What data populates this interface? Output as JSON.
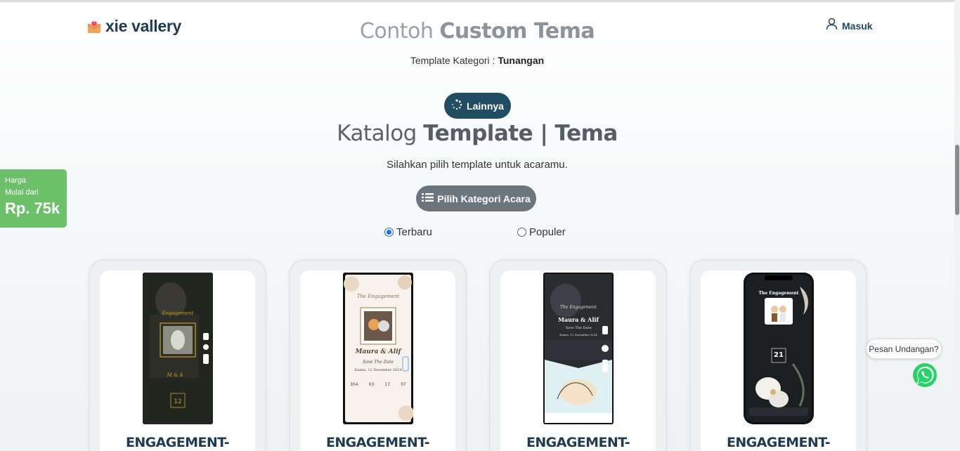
{
  "brand": {
    "name": "xie vallery"
  },
  "header": {
    "login_label": "Masuk"
  },
  "demo": {
    "title_light": "Contoh",
    "title_bold": "Custom Tema",
    "kategori_label": "Template Kategori :",
    "kategori_value": "Tunangan",
    "more_button": "Lainnya"
  },
  "catalog": {
    "title_light": "Katalog",
    "title_bold": "Template | Tema",
    "subtitle": "Silahkan pilih template untuk acaramu.",
    "category_button": "Pilih Kategori Acara",
    "sort_options": [
      {
        "label": "Terbaru",
        "selected": true
      },
      {
        "label": "Populer",
        "selected": false
      }
    ],
    "cards": [
      {
        "title": "ENGAGEMENT-"
      },
      {
        "title": "ENGAGEMENT-"
      },
      {
        "title": "ENGAGEMENT-"
      },
      {
        "title": "ENGAGEMENT-"
      }
    ]
  },
  "price_badge": {
    "line1": "Harga",
    "line2": "Mulai dari",
    "value": "Rp. 75k"
  },
  "whatsapp": {
    "bubble": "Pesan Undangan?"
  },
  "previews": {
    "p2": {
      "heading": "The Engagement",
      "names": "Maura & Alif",
      "save": "Save The Date",
      "date": "Kamis, 12 Desember 2024",
      "count": [
        "304",
        "03",
        "17",
        "07"
      ]
    },
    "p3": {
      "heading": "The Engagement",
      "names": "Maura & Alif",
      "save": "Save The Date",
      "date": "Kamis, 12 Desember 2024"
    },
    "p4": {
      "heading": "The Engagement",
      "day": "21"
    }
  },
  "colors": {
    "primary": "#214d63",
    "badge": "#6cc06a",
    "grey_button": "#6c757d",
    "whatsapp": "#25d366"
  }
}
